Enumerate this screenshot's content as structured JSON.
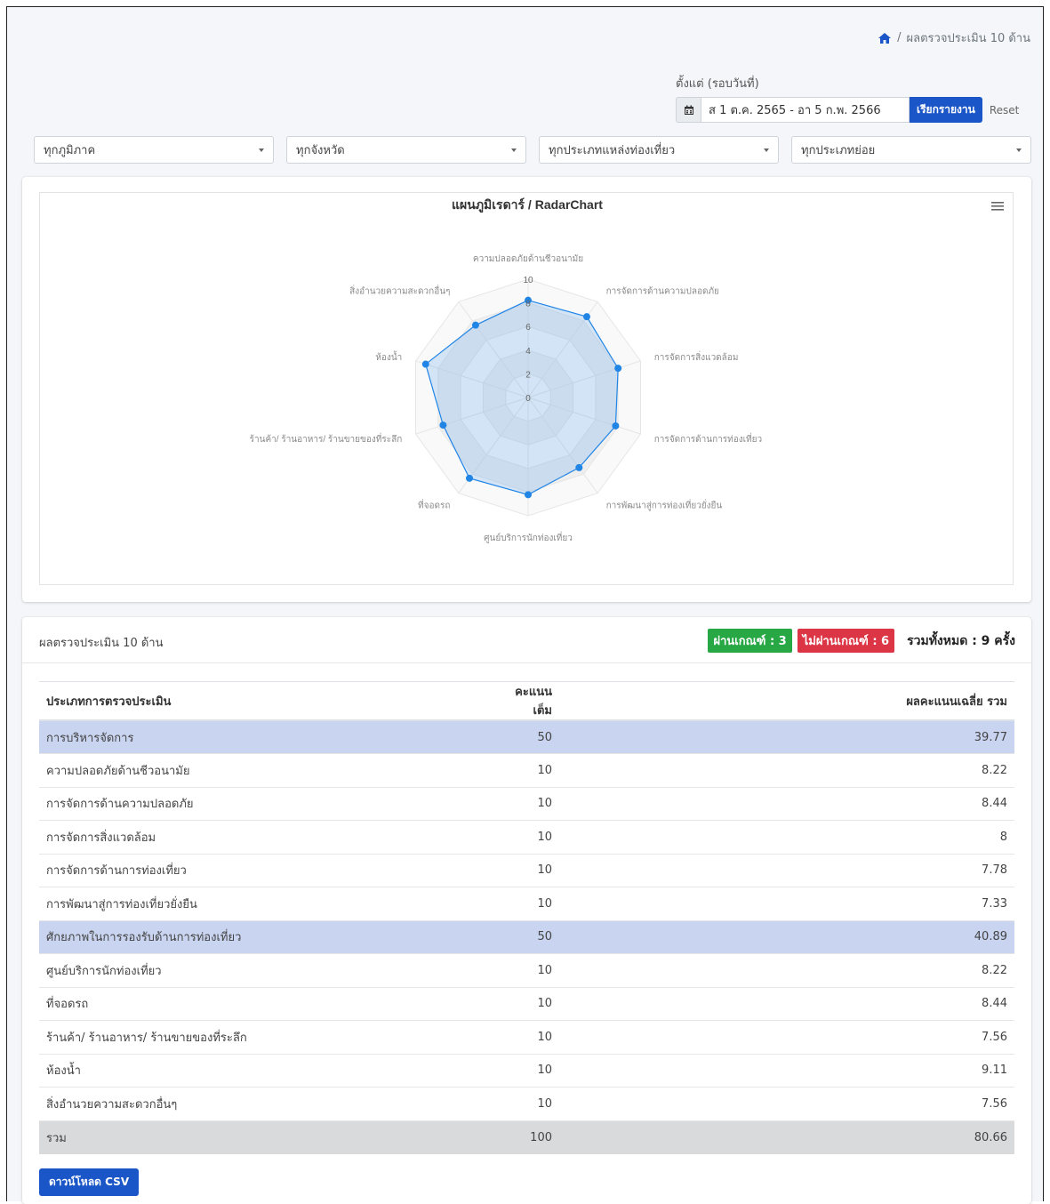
{
  "breadcrumb": {
    "current": "ผลตรวจประเมิน 10 ด้าน"
  },
  "date_filter": {
    "label": "ตั้งแต่ (รอบวันที่)",
    "value": "ส 1 ต.ค. 2565 - อา 5 ก.พ. 2566",
    "report_button": "เรียกรายงาน",
    "reset_button": "Reset"
  },
  "filters": [
    "ทุกภูมิภาค",
    "ทุกจังหวัด",
    "ทุกประเภทแหล่งท่องเที่ยว",
    "ทุกประเภทย่อย"
  ],
  "chart_card": {
    "title": "แผนภูมิเรดาร์ / RadarChart"
  },
  "chart_data": {
    "type": "radar",
    "title": "แผนภูมิเรดาร์ / RadarChart",
    "categories": [
      "ความปลอดภัยด้านชีวอนามัย",
      "การจัดการด้านความปลอดภัย",
      "การจัดการสิ่งแวดล้อม",
      "การจัดการด้านการท่องเที่ยว",
      "การพัฒนาสู่การท่องเที่ยวยั่งยืน",
      "ศูนย์บริการนักท่องเที่ยว",
      "ที่จอดรถ",
      "ร้านค้า/ ร้านอาหาร/ ร้านขายของที่ระลึก",
      "ห้องน้ำ",
      "สิ่งอำนวยความสะดวกอื่นๆ"
    ],
    "values": [
      8.22,
      8.44,
      8,
      7.78,
      7.33,
      8.22,
      8.44,
      7.56,
      9.11,
      7.56
    ],
    "rlim": [
      0,
      10
    ],
    "ticks": [
      "0",
      "2",
      "4",
      "6",
      "8",
      "10"
    ],
    "color": "#2185e6"
  },
  "summary": {
    "title": "ผลตรวจประเมิน 10 ด้าน",
    "pass_label": "ผ่านเกณฑ์ : 3",
    "fail_label": "ไม่ผ่านเกณฑ์ : 6",
    "total_label": "รวมทั้งหมด : 9 ครั้ง"
  },
  "table": {
    "headers": [
      "ประเภทการตรวจประเมิน",
      "คะแนนเต็ม",
      "ผลคะแนนเฉลี่ย รวม"
    ],
    "rows": [
      {
        "name": "การบริหารจัดการ",
        "full": "50",
        "avg": "39.77"
      },
      {
        "name": "ความปลอดภัยด้านชีวอนามัย",
        "full": "10",
        "avg": "8.22"
      },
      {
        "name": "การจัดการด้านความปลอดภัย",
        "full": "10",
        "avg": "8.44"
      },
      {
        "name": "การจัดการสิ่งแวดล้อม",
        "full": "10",
        "avg": "8"
      },
      {
        "name": "การจัดการด้านการท่องเที่ยว",
        "full": "10",
        "avg": "7.78"
      },
      {
        "name": "การพัฒนาสู่การท่องเที่ยวยั่งยืน",
        "full": "10",
        "avg": "7.33"
      },
      {
        "name": "ศักยภาพในการรองรับด้านการท่องเที่ยว",
        "full": "50",
        "avg": "40.89"
      },
      {
        "name": "ศูนย์บริการนักท่องเที่ยว",
        "full": "10",
        "avg": "8.22"
      },
      {
        "name": "ที่จอดรถ",
        "full": "10",
        "avg": "8.44"
      },
      {
        "name": "ร้านค้า/ ร้านอาหาร/ ร้านขายของที่ระลึก",
        "full": "10",
        "avg": "7.56"
      },
      {
        "name": "ห้องน้ำ",
        "full": "10",
        "avg": "9.11"
      },
      {
        "name": "สิ่งอำนวยความสะดวกอื่นๆ",
        "full": "10",
        "avg": "7.56"
      },
      {
        "name": "รวม",
        "full": "100",
        "avg": "80.66"
      }
    ]
  },
  "download_button": "ดาวน์โหลด CSV",
  "colors": {
    "primary": "#1a56c8",
    "pass": "#28a745",
    "fail": "#dc3545",
    "group_row": "#c9d4f0",
    "sum_row": "#d9dadb"
  }
}
